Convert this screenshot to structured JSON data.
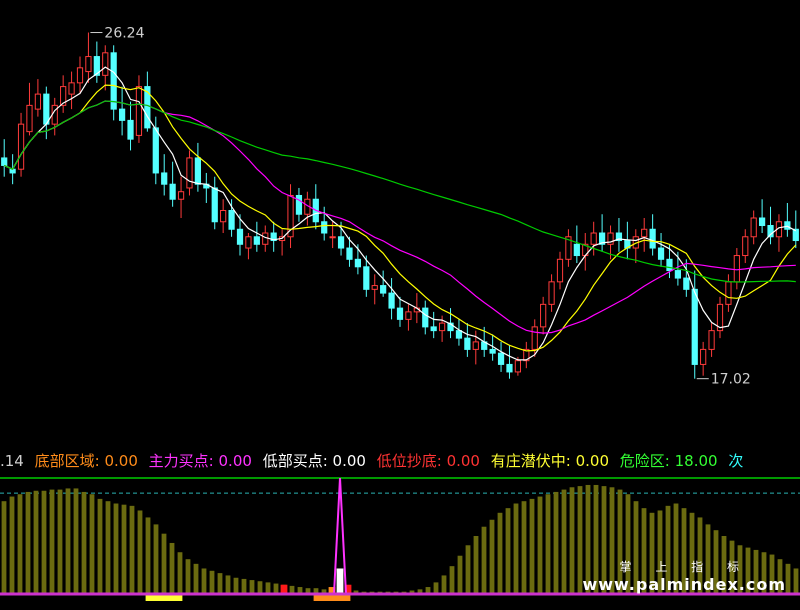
{
  "chart_data": [
    {
      "type": "candlestick",
      "title": "",
      "ylim": [
        15.6,
        27.0
      ],
      "annotations": [
        {
          "label": "26.24",
          "bar": 10,
          "price": 26.24
        },
        {
          "label": "17.02",
          "bar": 82,
          "price": 17.02
        }
      ],
      "series_colors": {
        "up": "#ff3b3b",
        "down": "#54ffff",
        "ma5": "#ffffff",
        "ma10": "#ffff00",
        "ma20": "#ff00ff",
        "ma60": "#00cc00"
      },
      "left_cut_label": ".14",
      "candles": [
        [
          22.9,
          23.4,
          22.4,
          22.7
        ],
        [
          22.6,
          23.0,
          22.2,
          22.5
        ],
        [
          22.6,
          24.1,
          22.4,
          23.8
        ],
        [
          23.6,
          24.9,
          23.5,
          24.3
        ],
        [
          24.2,
          25.0,
          24.0,
          24.6
        ],
        [
          24.6,
          24.8,
          23.4,
          23.8
        ],
        [
          23.8,
          24.5,
          23.5,
          24.3
        ],
        [
          24.3,
          25.1,
          24.1,
          24.8
        ],
        [
          24.6,
          25.2,
          24.2,
          24.9
        ],
        [
          24.9,
          25.6,
          24.6,
          25.3
        ],
        [
          25.2,
          26.24,
          24.9,
          25.6
        ],
        [
          25.6,
          26.0,
          24.9,
          25.1
        ],
        [
          25.1,
          25.9,
          24.7,
          25.7
        ],
        [
          25.7,
          25.9,
          23.9,
          24.2
        ],
        [
          24.2,
          24.8,
          23.5,
          23.9
        ],
        [
          23.9,
          24.4,
          23.1,
          23.4
        ],
        [
          23.5,
          25.1,
          23.3,
          24.8
        ],
        [
          24.8,
          25.2,
          23.6,
          23.7
        ],
        [
          23.7,
          24.0,
          22.2,
          22.5
        ],
        [
          22.5,
          23.0,
          21.9,
          22.2
        ],
        [
          22.2,
          22.8,
          21.6,
          21.8
        ],
        [
          21.8,
          22.4,
          21.3,
          22.0
        ],
        [
          22.1,
          23.1,
          21.9,
          22.9
        ],
        [
          22.9,
          23.3,
          22.0,
          22.2
        ],
        [
          22.2,
          22.5,
          21.7,
          22.1
        ],
        [
          22.1,
          22.4,
          21.0,
          21.2
        ],
        [
          21.2,
          21.8,
          20.9,
          21.5
        ],
        [
          21.5,
          21.8,
          20.8,
          21.0
        ],
        [
          21.0,
          21.4,
          20.3,
          20.6
        ],
        [
          20.5,
          20.9,
          20.2,
          20.8
        ],
        [
          20.8,
          21.2,
          20.4,
          20.6
        ],
        [
          20.6,
          21.1,
          20.4,
          20.9
        ],
        [
          20.9,
          21.2,
          20.4,
          20.7
        ],
        [
          20.7,
          21.0,
          20.3,
          20.8
        ],
        [
          20.8,
          22.2,
          20.5,
          21.9
        ],
        [
          21.9,
          22.1,
          21.2,
          21.4
        ],
        [
          21.4,
          22.0,
          21.1,
          21.8
        ],
        [
          21.8,
          22.2,
          21.0,
          21.2
        ],
        [
          21.2,
          21.6,
          20.7,
          20.9
        ],
        [
          20.8,
          21.2,
          20.5,
          20.8
        ],
        [
          20.8,
          21.2,
          20.3,
          20.5
        ],
        [
          20.5,
          20.8,
          20.0,
          20.2
        ],
        [
          20.2,
          20.6,
          19.8,
          20.0
        ],
        [
          20.0,
          20.3,
          19.2,
          19.4
        ],
        [
          19.4,
          19.8,
          19.0,
          19.5
        ],
        [
          19.5,
          19.9,
          19.2,
          19.3
        ],
        [
          19.3,
          19.7,
          18.6,
          18.9
        ],
        [
          18.9,
          19.2,
          18.4,
          18.6
        ],
        [
          18.6,
          19.0,
          18.3,
          18.8
        ],
        [
          18.8,
          19.3,
          18.5,
          18.9
        ],
        [
          18.9,
          19.1,
          18.2,
          18.4
        ],
        [
          18.4,
          18.8,
          18.1,
          18.3
        ],
        [
          18.3,
          18.7,
          18.0,
          18.5
        ],
        [
          18.5,
          18.9,
          18.1,
          18.3
        ],
        [
          18.3,
          18.6,
          17.9,
          18.1
        ],
        [
          18.1,
          18.5,
          17.6,
          17.8
        ],
        [
          17.8,
          18.3,
          17.4,
          18.0
        ],
        [
          18.0,
          18.4,
          17.6,
          17.8
        ],
        [
          17.8,
          18.2,
          17.5,
          17.7
        ],
        [
          17.7,
          18.0,
          17.2,
          17.4
        ],
        [
          17.4,
          17.9,
          17.02,
          17.2
        ],
        [
          17.2,
          17.6,
          17.1,
          17.5
        ],
        [
          17.5,
          18.0,
          17.3,
          17.8
        ],
        [
          17.8,
          18.6,
          17.6,
          18.4
        ],
        [
          18.4,
          19.2,
          18.2,
          19.0
        ],
        [
          19.0,
          19.8,
          18.8,
          19.6
        ],
        [
          19.6,
          20.4,
          19.4,
          20.2
        ],
        [
          20.2,
          21.0,
          20.0,
          20.8
        ],
        [
          20.6,
          21.1,
          20.1,
          20.3
        ],
        [
          20.3,
          20.9,
          19.9,
          20.6
        ],
        [
          20.6,
          21.2,
          20.3,
          20.9
        ],
        [
          20.9,
          21.4,
          20.4,
          20.6
        ],
        [
          20.6,
          21.1,
          20.2,
          20.9
        ],
        [
          20.9,
          21.3,
          20.4,
          20.7
        ],
        [
          20.7,
          21.2,
          20.2,
          20.5
        ],
        [
          20.5,
          21.0,
          20.1,
          20.8
        ],
        [
          20.8,
          21.3,
          20.4,
          21.0
        ],
        [
          21.0,
          21.4,
          20.3,
          20.5
        ],
        [
          20.5,
          20.9,
          20.0,
          20.2
        ],
        [
          20.2,
          20.6,
          19.7,
          19.9
        ],
        [
          19.9,
          20.4,
          19.5,
          19.7
        ],
        [
          19.7,
          20.2,
          19.2,
          19.4
        ],
        [
          19.4,
          19.9,
          17.02,
          17.4
        ],
        [
          17.4,
          18.0,
          17.1,
          17.8
        ],
        [
          17.8,
          18.5,
          17.6,
          18.3
        ],
        [
          18.3,
          19.2,
          18.1,
          19.0
        ],
        [
          19.0,
          19.8,
          18.8,
          19.6
        ],
        [
          19.6,
          20.5,
          19.4,
          20.3
        ],
        [
          20.3,
          21.0,
          20.1,
          20.8
        ],
        [
          20.8,
          21.5,
          20.6,
          21.3
        ],
        [
          21.3,
          21.8,
          20.9,
          21.1
        ],
        [
          21.1,
          21.6,
          20.6,
          20.8
        ],
        [
          20.8,
          21.4,
          20.4,
          21.2
        ],
        [
          21.2,
          21.7,
          20.8,
          21.0
        ],
        [
          21.0,
          21.5,
          20.5,
          20.7
        ]
      ]
    },
    {
      "type": "bar",
      "title": "",
      "ylim": [
        0,
        100
      ],
      "legend": [
        {
          "label": "底部区域:",
          "value": "0.00",
          "color": "#ff8c1a"
        },
        {
          "label": "主力买点:",
          "value": "0.00",
          "color": "#ff33ff"
        },
        {
          "label": "低部买点:",
          "value": "0.00",
          "color": "#ffffff"
        },
        {
          "label": "低位抄底:",
          "value": "0.00",
          "color": "#ff3333"
        },
        {
          "label": "有庄潜伏中:",
          "value": "0.00",
          "color": "#ffff33"
        },
        {
          "label": "危险区:",
          "value": "18.00",
          "color": "#33ff33"
        },
        {
          "label": "次",
          "value": "",
          "color": "#33ffff"
        }
      ],
      "left_cut_label": ".14",
      "colors": {
        "bars": "#6b6b10",
        "axis": "#cc33cc",
        "top_line": "#00cc00",
        "ref_line": "#2bb3b3"
      },
      "ref_levels": [
        100,
        87
      ],
      "values": [
        80,
        84,
        86,
        88,
        89,
        89,
        90,
        90,
        91,
        91,
        88,
        86,
        82,
        80,
        78,
        77,
        76,
        72,
        66,
        60,
        52,
        44,
        36,
        30,
        26,
        22,
        20,
        18,
        16,
        14,
        13,
        12,
        11,
        10,
        9,
        8,
        7,
        6,
        5,
        5,
        4,
        4,
        3,
        3,
        3,
        2,
        2,
        2,
        2,
        2,
        2,
        3,
        4,
        6,
        10,
        16,
        24,
        33,
        42,
        50,
        58,
        64,
        70,
        74,
        78,
        80,
        82,
        84,
        86,
        88,
        90,
        92,
        93,
        94,
        94,
        93,
        92,
        90,
        86,
        80,
        74,
        70,
        72,
        76,
        78,
        74,
        70,
        66,
        60,
        55,
        50,
        46,
        42,
        40,
        38,
        36,
        34,
        30,
        26,
        22
      ],
      "markers": [
        {
          "bar": 35,
          "height": 8,
          "color": "#ff1a1a"
        },
        {
          "bar": 42,
          "height": 22,
          "color": "#ffffff"
        },
        {
          "bar": 43,
          "height": 8,
          "color": "#ff1a1a"
        },
        {
          "bar": 41,
          "height": 6,
          "color": "#ff8c1a"
        }
      ],
      "spike": {
        "bar": 42,
        "value": 100,
        "color": "#ff33ff"
      },
      "low_strips": [
        {
          "from": 18,
          "to": 22,
          "color": "#ffff33"
        },
        {
          "from": 39,
          "to": 43,
          "color": "#ff8c1a"
        }
      ]
    }
  ],
  "watermark": {
    "top": "掌 上 指 标",
    "url": "www.palmindex.com"
  }
}
